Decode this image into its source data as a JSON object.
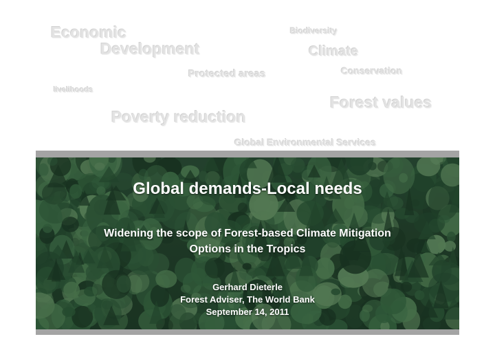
{
  "background_words": {
    "economic": "Economic",
    "development": "Development",
    "biodiversity": "Biodiversity",
    "climate": "Climate",
    "conservation": "Conservation",
    "protected_areas": "Protected areas",
    "livelihoods": "livelihoods",
    "forest_values": "Forest values",
    "poverty_reduction": "Poverty reduction",
    "global_environmental_services": "Global Environmental Services"
  },
  "banner": {
    "title": "Global demands-Local needs",
    "subtitle_line1": "Widening the scope of Forest-based Climate Mitigation",
    "subtitle_line2": "Options in the Tropics",
    "author": "Gerhard Dieterle",
    "role": "Forest Adviser, The World Bank",
    "date": "September 14, 2011"
  },
  "colors": {
    "watermark_text": "#e3e3e3",
    "banner_frame": "#a8a8a8",
    "forest_dark": "#1f3a27",
    "title_text": "#ffffff"
  }
}
